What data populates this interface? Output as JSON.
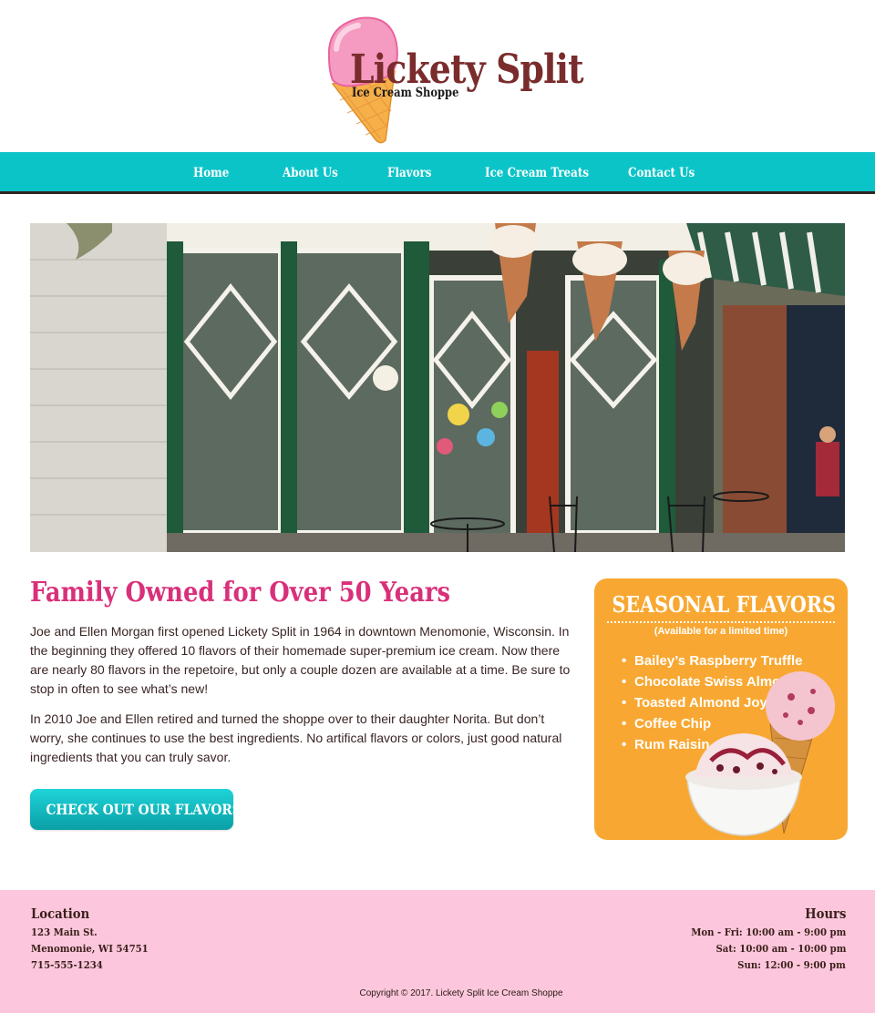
{
  "logo": {
    "title": "Lickety Split",
    "subtitle": "Ice Cream Shoppe"
  },
  "nav": {
    "items": [
      "Home",
      "About Us",
      "Flavors",
      "Ice Cream Treats",
      "Contact Us"
    ]
  },
  "hero": {
    "alt": ""
  },
  "main": {
    "heading": "Family Owned for Over 50 Years",
    "paragraphs": [
      "Joe and Ellen Morgan first opened Lickety Split in 1964 in downtown Menomonie, Wisconsin. In the beginning they offered 10 flavors of their homemade super-premium ice cream. Now there are nearly 80 flavors in the repetoire, but only a couple dozen are available at a time. Be sure to stop in often to see what’s new!",
      "In 2010 Joe and Ellen retired and turned the shoppe over to their daughter Norita. But don’t worry, she continues to use the best ingredients. No artifical flavors or colors, just good natural ingredients that you can truly savor."
    ],
    "cta_label": "CHECK OUT OUR FLAVORS"
  },
  "seasonal": {
    "title": "SEASONAL FLAVORS",
    "subtitle": "(Available for a limited time)",
    "flavors": [
      "Bailey’s Raspberry Truffle",
      "Chocolate Swiss Almond",
      "Toasted Almond Joy",
      "Coffee Chip",
      "Rum Raisin"
    ]
  },
  "footer": {
    "location_heading": "Location",
    "address": [
      "123 Main St.",
      "Menomonie, WI 54751",
      "715-555-1234"
    ],
    "hours_heading": "Hours",
    "hours": [
      "Mon - Fri: 10:00 am - 9:00 pm",
      "Sat: 10:00 am - 10:00 pm",
      "Sun: 12:00 - 9:00 pm"
    ],
    "copyright": "Copyright © 2017. Lickety Split Ice Cream Shoppe"
  },
  "colors": {
    "nav": "#0bc4c8",
    "heading_pink": "#d9307a",
    "seasonal_orange": "#f8a832",
    "footer_pink": "#fcc7dc",
    "logo_brown": "#7a2c2c"
  }
}
